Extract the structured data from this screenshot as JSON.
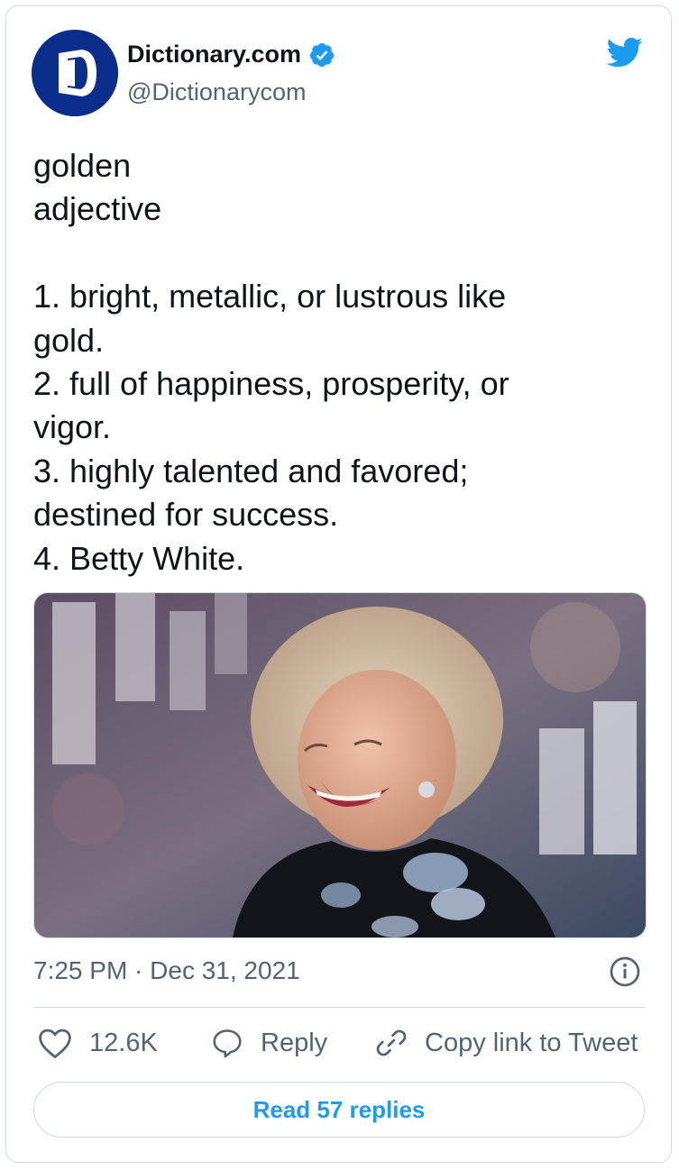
{
  "tweet": {
    "account_name": "Dictionary.com",
    "handle": "@Dictionarycom",
    "text": "golden\nadjective\n\n1. bright, metallic, or lustrous like\ngold.\n2. full of happiness, prosperity, or\nvigor.\n3. highly talented and favored;\ndestined for success.\n4. Betty White.",
    "timestamp": "7:25 PM · Dec 31, 2021",
    "verified": true
  },
  "actions": {
    "like_count": "12.6K",
    "reply_label": "Reply",
    "copy_label": "Copy link to Tweet"
  },
  "read_replies_label": "Read 57 replies",
  "icons": {
    "logo": "dictionary-logo-icon",
    "verified": "verified-badge-icon",
    "brand": "twitter-bird-icon",
    "info": "info-icon",
    "like": "heart-icon",
    "reply": "speech-bubble-icon",
    "copy": "link-icon"
  },
  "colors": {
    "accent": "#1d9bf0",
    "text_primary": "#0f1419",
    "text_secondary": "#536471",
    "border": "#cfd9de",
    "logo_bg": "#0b2d8c"
  }
}
